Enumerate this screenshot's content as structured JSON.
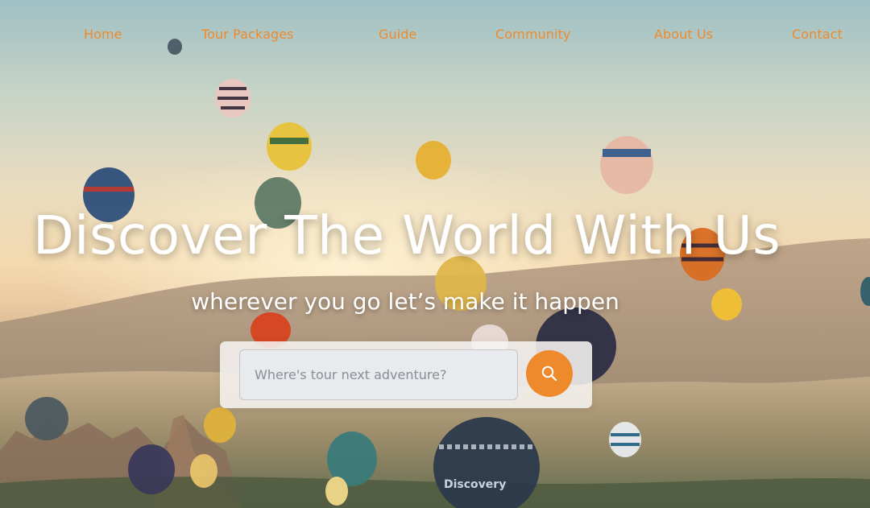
{
  "nav": {
    "items": [
      {
        "label": "Home"
      },
      {
        "label": "Tour Packages"
      },
      {
        "label": "Guide"
      },
      {
        "label": "Community"
      },
      {
        "label": "About Us"
      },
      {
        "label": "Contact"
      }
    ]
  },
  "hero": {
    "title": "Discover The World With Us",
    "subtitle": "wherever you go let’s make it happen"
  },
  "search": {
    "placeholder": "Where's tour next adventure?",
    "value": "",
    "button_icon": "search-icon"
  },
  "background": {
    "scene": "hot-air-balloons-icon",
    "balloon_text": "Discovery"
  },
  "colors": {
    "accent": "#ee8a2c",
    "text_light": "#ffffff"
  }
}
